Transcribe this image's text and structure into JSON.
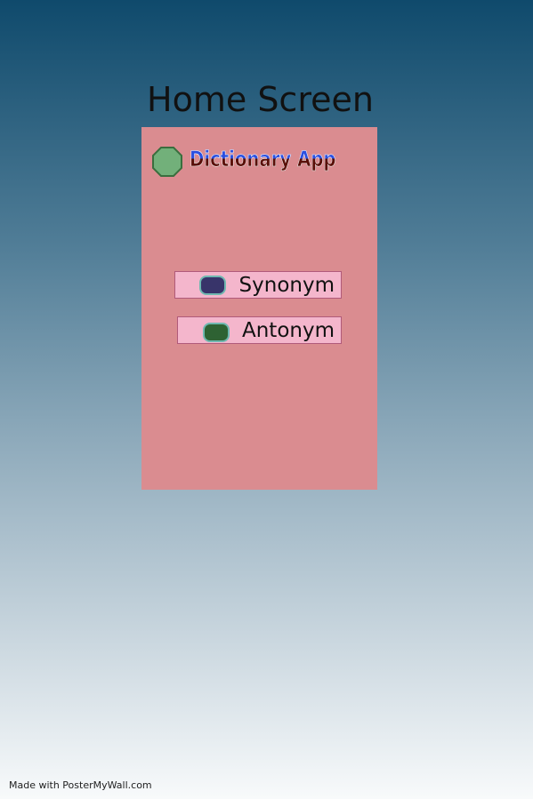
{
  "page_title": "Home Screen",
  "app": {
    "title": "Dictionary App",
    "buttons": [
      {
        "label": "Synonym",
        "color": "#38346a"
      },
      {
        "label": "Antonym",
        "color": "#2e6233"
      }
    ]
  },
  "footer": "Made with PosterMyWall.com"
}
